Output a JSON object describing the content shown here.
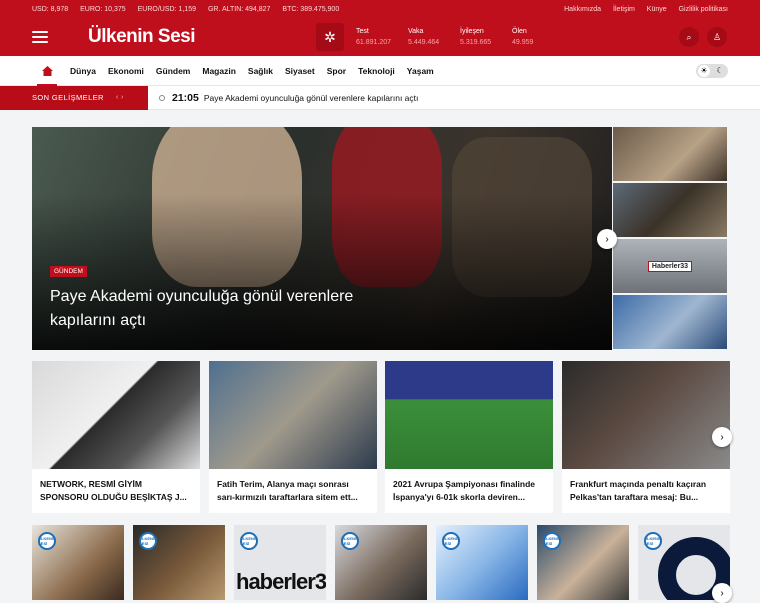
{
  "ticker": {
    "usd": "USD: 8,978",
    "euro": "EURO: 10,375",
    "eurusd": "EURO/USD: 1,159",
    "gold": "GR. ALTIN: 494,827",
    "btc": "BTC: 389.475,900"
  },
  "top_links": [
    "Hakkımızda",
    "İletişim",
    "Künye",
    "Gizlilik politikası"
  ],
  "header": {
    "logo": "Ülkenin Sesi",
    "stats": [
      {
        "label": "Test",
        "value": "61.891.207"
      },
      {
        "label": "Vaka",
        "value": "5.449.464"
      },
      {
        "label": "İyileşen",
        "value": "5.319.665"
      },
      {
        "label": "Ölen",
        "value": "49.959"
      }
    ]
  },
  "nav": {
    "items": [
      "Dünya",
      "Ekonomi",
      "Gündem",
      "Magazin",
      "Sağlık",
      "Siyaset",
      "Spor",
      "Teknoloji",
      "Yaşam"
    ]
  },
  "breaking": {
    "label": "SON GELİŞMELER",
    "time": "21:05",
    "headline": "Paye Akademi oyunculuğa gönül verenlere kapılarını açtı"
  },
  "hero": {
    "category": "GÜNDEM",
    "title": "Paye Akademi oyunculuğa gönül verenlere kapılarını açtı",
    "thumb_logo": "Haberler33"
  },
  "cards": [
    {
      "title": "NETWORK, RESMİ GİYİM SPONSORU OLDUĞU BEŞİKTAŞ J..."
    },
    {
      "title": "Fatih Terim, Alanya maçı sonrası sarı-kırmızılı taraftarlara sitem ett..."
    },
    {
      "title": "2021 Avrupa Şampiyonası finalinde İspanya'yı 6-01k skorla deviren..."
    },
    {
      "title": "Frankfurt maçında penaltı kaçıran Pelkas'tan taraftara mesaj: Bu..."
    }
  ],
  "small_badge": "ÜLKENİN SESİ",
  "small_logo_text": "haberler3",
  "icons": {
    "home": "home-icon",
    "search": "search-icon",
    "user": "user-icon",
    "virus": "virus-icon",
    "sun": "sun-icon",
    "moon": "moon-icon",
    "next": "chevron-right-icon"
  },
  "colors": {
    "brand": "#c00f1c",
    "brand_dark": "#a50b16"
  }
}
